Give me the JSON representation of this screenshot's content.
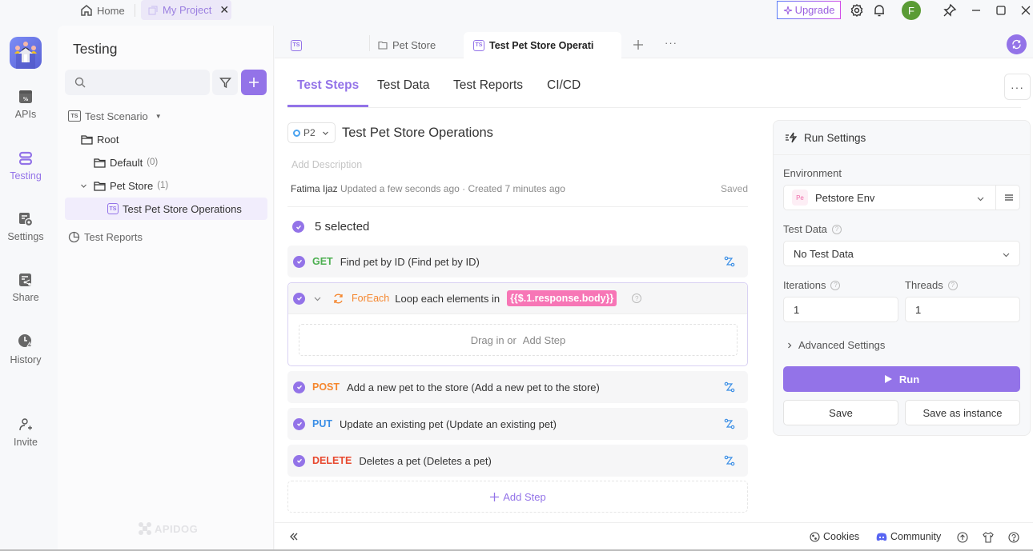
{
  "titlebar": {
    "home_label": "Home",
    "project_tab_label": "My Project",
    "upgrade_label": "Upgrade",
    "avatar_initial": "F",
    "colors": {
      "accent": "#9373e8",
      "avatar": "#5a9b35"
    }
  },
  "rail": {
    "items": [
      {
        "label": "APIs",
        "icon": "api-icon"
      },
      {
        "label": "Testing",
        "icon": "testing-icon",
        "active": true
      },
      {
        "label": "Settings",
        "icon": "settings-icon"
      },
      {
        "label": "Share",
        "icon": "share-icon"
      },
      {
        "label": "History",
        "icon": "history-icon"
      },
      {
        "label": "Invite",
        "icon": "invite-icon"
      }
    ]
  },
  "sidebar": {
    "title": "Testing",
    "search_placeholder": "",
    "tree": {
      "scenario_root": "Test Scenario",
      "root": "Root",
      "default_folder": {
        "label": "Default",
        "count": "(0)"
      },
      "petstore_folder": {
        "label": "Pet Store",
        "count": "(1)"
      },
      "selected_item": "Test Pet Store Operations",
      "reports": "Test Reports"
    },
    "brand_watermark": "APIDOG"
  },
  "doc_tabs": {
    "tabs": [
      {
        "label": "",
        "icon": "test-scenario-icon"
      },
      {
        "label": "Pet Store",
        "icon": "folder-icon"
      },
      {
        "label": "Test Pet Store Operati",
        "icon": "test-scenario-icon",
        "active": true
      }
    ]
  },
  "sub_tabs": [
    "Test Steps",
    "Test Data",
    "Test Reports",
    "CI/CD"
  ],
  "scenario": {
    "priority": "P2",
    "title": "Test Pet Store Operations",
    "description_placeholder": "Add Description",
    "author": "Fatima Ijaz",
    "meta": "Updated a few seconds ago · Created 7 minutes ago",
    "save_status": "Saved",
    "selected_count_label": "5 selected"
  },
  "steps": [
    {
      "method": "GET",
      "color": "#4caf50",
      "label": "Find pet by ID (Find pet by ID)"
    },
    {
      "method": "POST",
      "color": "#f5872f",
      "label": "Add a new pet to the store (Add a new pet to the store)"
    },
    {
      "method": "PUT",
      "color": "#3a8ee6",
      "label": "Update an existing pet (Update an existing pet)"
    },
    {
      "method": "DELETE",
      "color": "#e8482e",
      "label": "Deletes a pet (Deletes a pet)"
    }
  ],
  "foreach": {
    "keyword": "ForEach",
    "text": "Loop each elements in",
    "expression": "{{$.1.response.body}}",
    "dropzone_text": "Drag in or",
    "dropzone_link": "Add Step"
  },
  "add_step_label": "Add Step",
  "run_settings": {
    "title": "Run Settings",
    "environment_label": "Environment",
    "environment_badge": "Pe",
    "environment_value": "Petstore Env",
    "test_data_label": "Test Data",
    "test_data_value": "No Test Data",
    "iterations_label": "Iterations",
    "iterations_value": "1",
    "threads_label": "Threads",
    "threads_value": "1",
    "advanced_label": "Advanced Settings",
    "run_label": "Run",
    "save_label": "Save",
    "save_instance_label": "Save as instance"
  },
  "footer": {
    "cookies_label": "Cookies",
    "community_label": "Community"
  }
}
